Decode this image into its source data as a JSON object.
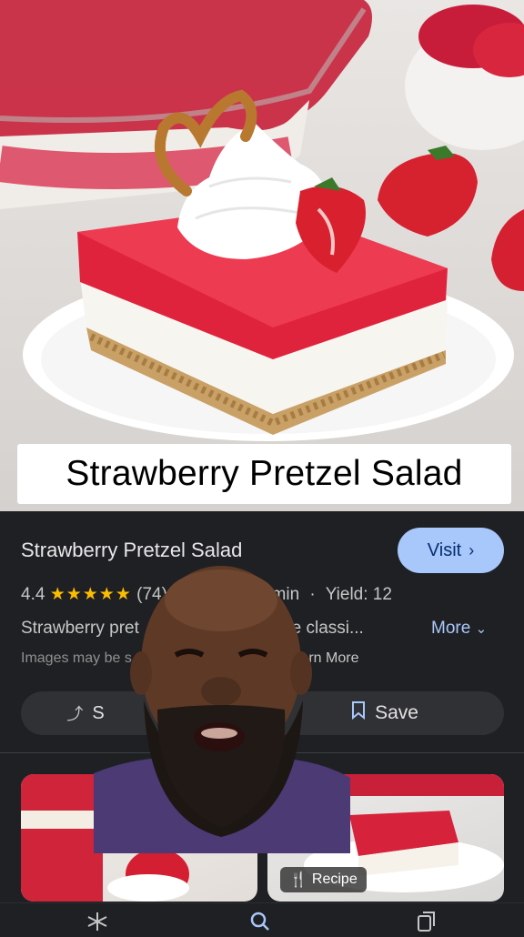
{
  "hero": {
    "caption": "Strawberry Pretzel Salad"
  },
  "result": {
    "title": "Strawberry Pretzel Salad",
    "visit_label": "Visit",
    "rating": "4.4",
    "stars": "★★★★★",
    "review_count": "(74)",
    "time_fragment": "min",
    "yield": "Yield: 12",
    "desc_start": "Strawberry pret",
    "desc_end": "intage classi...",
    "more_label": "More",
    "note_start": "Images may be s",
    "note_mid": ".",
    "learn_more": "Learn More",
    "share_fragment": "S",
    "save_label": "Save",
    "recipe_tag": "Recipe"
  },
  "colors": {
    "background": "#1f2023",
    "accent_button": "#a8c7fa",
    "star": "#fbbc04",
    "pill_button": "#303134"
  },
  "icons": {
    "visit": "chevron-right-icon",
    "more": "chevron-down-icon",
    "share": "share-icon",
    "save": "bookmark-icon",
    "recipe": "fork-knife-icon",
    "nav": [
      "discover-icon",
      "search-icon",
      "tabs-icon"
    ]
  }
}
